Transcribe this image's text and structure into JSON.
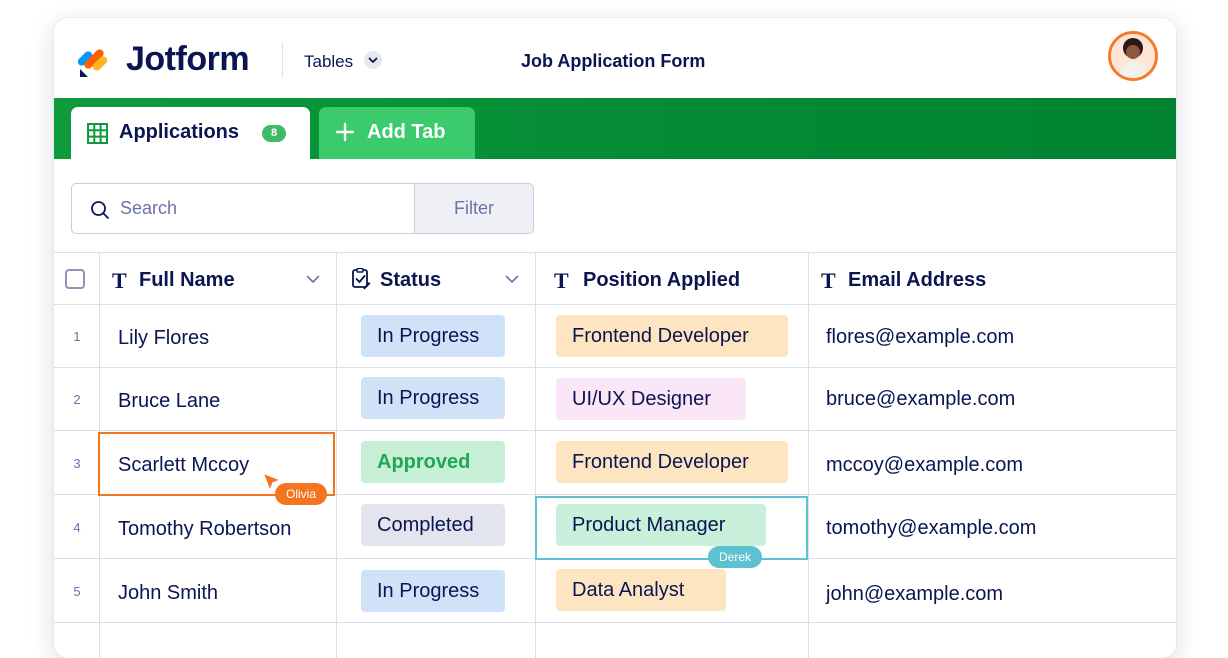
{
  "app": {
    "logo_text": "Jotform",
    "section_label": "Tables",
    "form_title": "Job Application Form"
  },
  "tabs": {
    "active": {
      "label": "Applications",
      "count": "8"
    },
    "add_label": "Add Tab"
  },
  "toolbar": {
    "search_placeholder": "Search",
    "filter_label": "Filter"
  },
  "columns": [
    {
      "label": "Full Name",
      "icon": "text-type-icon"
    },
    {
      "label": "Status",
      "icon": "status-checklist-icon"
    },
    {
      "label": "Position Applied",
      "icon": "text-type-icon"
    },
    {
      "label": "Email Address",
      "icon": "text-type-icon"
    }
  ],
  "rows": [
    {
      "num": "1",
      "name": "Lily Flores",
      "status": "In Progress",
      "position": "Frontend Developer",
      "email": "flores@example.com"
    },
    {
      "num": "2",
      "name": "Bruce Lane",
      "status": "In Progress",
      "position": "UI/UX Designer",
      "email": "bruce@example.com"
    },
    {
      "num": "3",
      "name": "Scarlett Mccoy",
      "status": "Approved",
      "position": "Frontend Developer",
      "email": "mccoy@example.com"
    },
    {
      "num": "4",
      "name": "Tomothy Robertson",
      "status": "Completed",
      "position": "Product Manager",
      "email": "tomothy@example.com"
    },
    {
      "num": "5",
      "name": "John Smith",
      "status": "In Progress",
      "position": "Data Analyst",
      "email": "john@example.com"
    }
  ],
  "collaborators": {
    "olivia": "Olivia",
    "derek": "Derek"
  },
  "colors": {
    "brand_green": "#018331",
    "accent_orange": "#f4751f",
    "accent_teal": "#5ec1cf",
    "navy": "#0a1551"
  }
}
